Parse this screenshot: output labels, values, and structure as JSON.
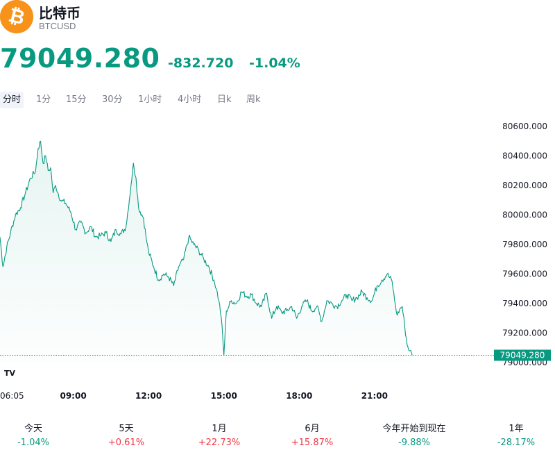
{
  "header": {
    "name": "比特币",
    "ticker": "BTCUSD",
    "logo_icon": "bitcoin-icon",
    "logo_color": "#f7931a"
  },
  "quote": {
    "price": "79049.280",
    "change": "-832.720",
    "change_pct": "-1.04%",
    "color": "#089981"
  },
  "tabs": [
    {
      "label": "分时",
      "active": true
    },
    {
      "label": "1分"
    },
    {
      "label": "15分"
    },
    {
      "label": "30分"
    },
    {
      "label": "1小时"
    },
    {
      "label": "4小时"
    },
    {
      "label": "日k"
    },
    {
      "label": "周k"
    }
  ],
  "chart_data": {
    "type": "area",
    "ylim": [
      79000,
      80600
    ],
    "y_ticks": [
      "80600.000",
      "80400.000",
      "80200.000",
      "80000.000",
      "79800.000",
      "79600.000",
      "79400.000",
      "79200.000",
      "79000.000"
    ],
    "y_tick_values": [
      80600,
      80400,
      80200,
      80000,
      79800,
      79600,
      79400,
      79200,
      79000
    ],
    "x_labels": [
      "06:05",
      "09:00",
      "12:00",
      "15:00",
      "18:00",
      "21:00"
    ],
    "x_label_hours": [
      6.0833,
      9,
      12,
      15,
      18,
      21
    ],
    "last_price_label": "79049.280",
    "last_price": 79049.28,
    "line_color": "#089981",
    "watermark": "TV",
    "x": [
      6.0833,
      6.2,
      6.35,
      6.5,
      6.7,
      6.9,
      7.1,
      7.3,
      7.5,
      7.6,
      7.7,
      7.8,
      7.9,
      8.0,
      8.1,
      8.2,
      8.3,
      8.5,
      8.7,
      8.9,
      9.1,
      9.3,
      9.5,
      9.7,
      9.9,
      10.1,
      10.3,
      10.5,
      10.7,
      10.9,
      11.1,
      11.3,
      11.4,
      11.5,
      11.6,
      11.8,
      11.9,
      12.0,
      12.2,
      12.4,
      12.6,
      12.8,
      13.0,
      13.2,
      13.4,
      13.6,
      13.8,
      14.0,
      14.2,
      14.4,
      14.6,
      14.7,
      14.8,
      14.9,
      15.0,
      15.1,
      15.3,
      15.5,
      15.7,
      15.9,
      16.1,
      16.3,
      16.5,
      16.7,
      16.9,
      17.1,
      17.3,
      17.5,
      17.7,
      17.9,
      18.1,
      18.3,
      18.5,
      18.7,
      18.9,
      19.1,
      19.3,
      19.5,
      19.7,
      19.9,
      20.1,
      20.3,
      20.5,
      20.7,
      20.9,
      21.1,
      21.3,
      21.5,
      21.7,
      21.8,
      21.9,
      22.0,
      22.1,
      22.2,
      22.3,
      22.4,
      22.5
    ],
    "y": [
      79850,
      79650,
      79780,
      79880,
      80000,
      80050,
      80150,
      80250,
      80300,
      80450,
      80500,
      80350,
      80400,
      80300,
      80320,
      80150,
      80200,
      80100,
      80080,
      80020,
      79900,
      79950,
      79880,
      79920,
      79850,
      79860,
      79880,
      79820,
      79900,
      79870,
      79920,
      80200,
      80350,
      80250,
      80050,
      79980,
      79850,
      79750,
      79650,
      79560,
      79600,
      79580,
      79520,
      79650,
      79700,
      79850,
      79800,
      79760,
      79700,
      79650,
      79560,
      79500,
      79420,
      79300,
      79050,
      79350,
      79420,
      79400,
      79480,
      79450,
      79460,
      79400,
      79380,
      79470,
      79300,
      79380,
      79340,
      79350,
      79380,
      79300,
      79380,
      79420,
      79350,
      79380,
      79280,
      79420,
      79400,
      79380,
      79420,
      79460,
      79420,
      79440,
      79480,
      79440,
      79420,
      79520,
      79560,
      79600,
      79550,
      79420,
      79320,
      79360,
      79380,
      79250,
      79120,
      79080,
      79049.28
    ]
  },
  "performance": [
    {
      "label": "今天",
      "value": "-1.04%",
      "color": "#089981"
    },
    {
      "label": "5天",
      "value": "+0.61%",
      "color": "#f23645"
    },
    {
      "label": "1月",
      "value": "+22.73%",
      "color": "#f23645"
    },
    {
      "label": "6月",
      "value": "+15.87%",
      "color": "#f23645"
    },
    {
      "label": "今年开始到现在",
      "value": "-9.88%",
      "color": "#089981"
    },
    {
      "label": "1年",
      "value": "-28.17%",
      "color": "#089981"
    }
  ]
}
